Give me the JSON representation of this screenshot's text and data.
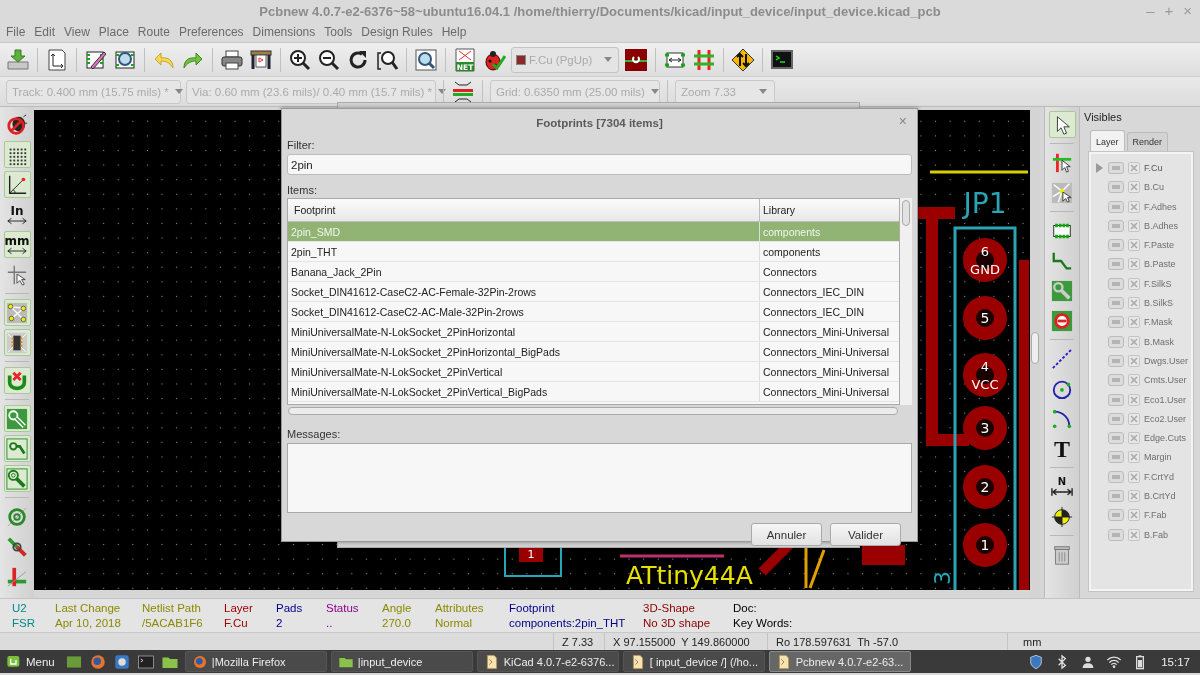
{
  "window": {
    "title": "Pcbnew 4.0.7-e2-6376~58~ubuntu16.04.1 /home/thierry/Documents/kicad/input_device/input_device.kicad_pcb",
    "controls": [
      "–",
      "+",
      "×"
    ]
  },
  "menu": [
    "File",
    "Edit",
    "View",
    "Place",
    "Route",
    "Preferences",
    "Dimensions",
    "Tools",
    "Design Rules",
    "Help"
  ],
  "main_toolbar": {
    "netlist_icon_text": "NET",
    "layer_select": "F.Cu (PgUp)"
  },
  "options_toolbar": {
    "track": "Track: 0.400 mm (15.75 mils) *",
    "via": "Via: 0.60 mm (23.6 mils)/ 0.40 mm (15.7 mils) *",
    "grid": "Grid: 0.6350 mm (25.00 mils)",
    "zoom": "Zoom 7.33"
  },
  "left_toolbar": [
    {
      "on": false
    },
    {
      "on": true
    },
    {
      "on": true
    },
    {
      "on": false,
      "glyph": "In"
    },
    {
      "on": true,
      "glyph": "mm"
    },
    {
      "on": false
    },
    {
      "on": true
    },
    {
      "on": true
    },
    {
      "on": true
    },
    {
      "on": true
    },
    {
      "on": true
    },
    {
      "on": true
    },
    {
      "on": false
    },
    {
      "on": false
    },
    {
      "on": false
    }
  ],
  "right_toolbar": [
    {
      "selected": true
    },
    {
      "selected": false
    },
    {
      "selected": false
    },
    {
      "selected": false
    },
    {
      "selected": false
    },
    {
      "selected": false
    },
    {
      "selected": false
    },
    {
      "selected": false
    },
    {
      "selected": false
    },
    {
      "selected": false
    },
    {
      "selected": false,
      "glyph": "T"
    },
    {
      "selected": false,
      "glyph": "N"
    },
    {
      "selected": false
    },
    {
      "selected": false
    }
  ],
  "canvas": {
    "reference": "JP1",
    "pads": [
      {
        "number": "6",
        "net": "GND"
      },
      {
        "number": "5"
      },
      {
        "number": "4",
        "net": "VCC"
      },
      {
        "number": "3"
      },
      {
        "number": "2"
      },
      {
        "number": "1"
      }
    ],
    "chip_label": "ATtiny44A",
    "chip_pad": "1",
    "rotated_label": "3"
  },
  "visibles": {
    "title": "Visibles",
    "tabs": [
      {
        "label": "Layer",
        "selected": true
      },
      {
        "label": "Render",
        "selected": false
      }
    ],
    "layers": [
      {
        "name": "F.Cu",
        "checked": true,
        "selected": true
      },
      {
        "name": "B.Cu",
        "checked": true,
        "selected": false
      },
      {
        "name": "F.Adhes",
        "checked": true,
        "selected": false
      },
      {
        "name": "B.Adhes",
        "checked": true,
        "selected": false
      },
      {
        "name": "F.Paste",
        "checked": true,
        "selected": false
      },
      {
        "name": "B.Paste",
        "checked": true,
        "selected": false
      },
      {
        "name": "F.SilkS",
        "checked": true,
        "selected": false
      },
      {
        "name": "B.SilkS",
        "checked": true,
        "selected": false
      },
      {
        "name": "F.Mask",
        "checked": true,
        "selected": false
      },
      {
        "name": "B.Mask",
        "checked": true,
        "selected": false
      },
      {
        "name": "Dwgs.User",
        "checked": true,
        "selected": false
      },
      {
        "name": "Cmts.User",
        "checked": true,
        "selected": false
      },
      {
        "name": "Eco1.User",
        "checked": true,
        "selected": false
      },
      {
        "name": "Eco2.User",
        "checked": true,
        "selected": false
      },
      {
        "name": "Edge.Cuts",
        "checked": true,
        "selected": false
      },
      {
        "name": "Margin",
        "checked": true,
        "selected": false
      },
      {
        "name": "F.CrtYd",
        "checked": true,
        "selected": false
      },
      {
        "name": "B.CrtYd",
        "checked": true,
        "selected": false
      },
      {
        "name": "F.Fab",
        "checked": true,
        "selected": false
      },
      {
        "name": "B.Fab",
        "checked": true,
        "selected": false
      }
    ]
  },
  "dialog": {
    "title": "Footprints [7304 items]",
    "close": "×",
    "filter_label": "Filter:",
    "filter": "2pin",
    "items_label": "Items:",
    "columns": [
      "Footprint",
      "Library"
    ],
    "rows": [
      {
        "footprint": "2pin_SMD",
        "library": "components",
        "selected": true
      },
      {
        "footprint": "2pin_THT",
        "library": "components",
        "selected": false
      },
      {
        "footprint": "Banana_Jack_2Pin",
        "library": "Connectors",
        "selected": false
      },
      {
        "footprint": "Socket_DIN41612-CaseC2-AC-Female-32Pin-2rows",
        "library": "Connectors_IEC_DIN",
        "selected": false
      },
      {
        "footprint": "Socket_DIN41612-CaseC2-AC-Male-32Pin-2rows",
        "library": "Connectors_IEC_DIN",
        "selected": false
      },
      {
        "footprint": "MiniUniversalMate-N-LokSocket_2PinHorizontal",
        "library": "Connectors_Mini-Universal",
        "selected": false
      },
      {
        "footprint": "MiniUniversalMate-N-LokSocket_2PinHorizontal_BigPads",
        "library": "Connectors_Mini-Universal",
        "selected": false
      },
      {
        "footprint": "MiniUniversalMate-N-LokSocket_2PinVertical",
        "library": "Connectors_Mini-Universal",
        "selected": false
      },
      {
        "footprint": "MiniUniversalMate-N-LokSocket_2PinVertical_BigPads",
        "library": "Connectors_Mini-Universal",
        "selected": false
      }
    ],
    "messages_label": "Messages:",
    "buttons": [
      "Annuler",
      "Valider"
    ]
  },
  "status": [
    {
      "label": "U2",
      "value": "FSR",
      "color": "#008a8a"
    },
    {
      "label": "Last Change",
      "value": "Apr 10, 2018",
      "color": "#8a8a00"
    },
    {
      "label": "Netlist Path",
      "value": "/5ACAB1F6",
      "color": "#8a8a00"
    },
    {
      "label": "Layer",
      "value": "F.Cu",
      "color": "#a00000"
    },
    {
      "label": "Pads",
      "value": "2",
      "color": "#00008a"
    },
    {
      "label": "Status",
      "value": "..",
      "color": "#8a008a"
    },
    {
      "label": "Angle",
      "value": "270.0",
      "color": "#8a8a00"
    },
    {
      "label": "Attributes",
      "value": "Normal",
      "color": "#8a8a00"
    },
    {
      "label": "Footprint",
      "value": "components:2pin_THT",
      "color": "#00008a"
    },
    {
      "label": "3D-Shape",
      "value": "No 3D shape",
      "color": "#8a0000"
    },
    {
      "label": "Doc:",
      "value": "Key Words:",
      "color": "#000000"
    }
  ],
  "coordinates": [
    "Z 7.33",
    "X 97.155000  Y 149.860000",
    "Ro 178.597631  Th -57.0",
    "mm"
  ],
  "taskbar": {
    "menu": "Menu",
    "tasks": [
      {
        "label": "|Mozilla Firefox",
        "selected": false
      },
      {
        "label": "|input_device",
        "selected": false
      },
      {
        "label": "KiCad 4.0.7-e2-6376...",
        "selected": false
      },
      {
        "label": "[ input_device /] (/ho...",
        "selected": false
      },
      {
        "label": "Pcbnew 4.0.7-e2-63...",
        "selected": true
      }
    ],
    "clock": "15:17"
  }
}
